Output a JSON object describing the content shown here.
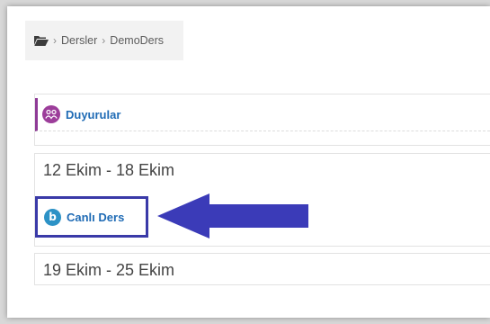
{
  "breadcrumb": {
    "icon": "folder-open-icon",
    "items": [
      "Dersler",
      "DemoDers"
    ],
    "separator": "›"
  },
  "sections": {
    "general": {
      "activity_label": "Duyurular",
      "activity_icon": "forum-icon",
      "accent_color": "#8e3a96"
    },
    "week1": {
      "title": "12 Ekim - 18 Ekim",
      "activity_label": "Canlı Ders",
      "activity_icon": "bigbluebutton-icon"
    },
    "week2": {
      "title": "19 Ekim - 25 Ekim"
    }
  },
  "annotation": {
    "highlight_color": "#3a3aa8",
    "arrow_color": "#3b3bb8",
    "arrow_icon": "arrow-left-icon"
  }
}
